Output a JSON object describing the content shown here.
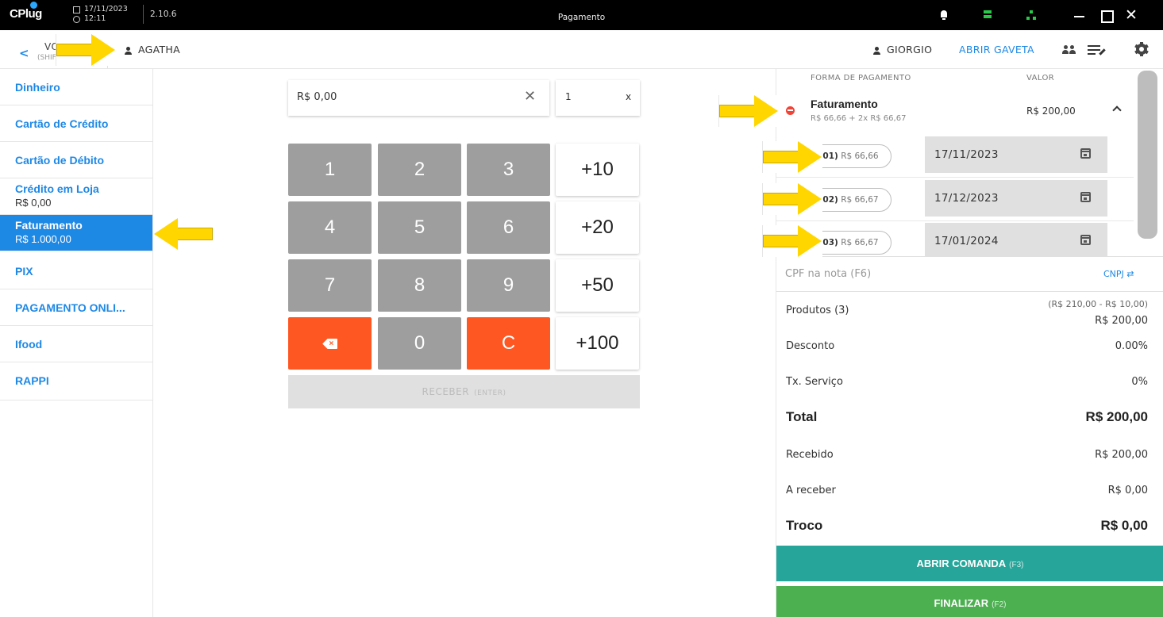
{
  "titlebar": {
    "brand": "CPlug",
    "date": "17/11/2023",
    "time": "12:11",
    "version": "2.10.6",
    "window_title": "Pagamento"
  },
  "header": {
    "back_label": "VOLTAR",
    "back_hint": "(SHIFT+ESC)",
    "client": "AGATHA",
    "operator": "GIORGIO",
    "open_drawer": "ABRIR GAVETA"
  },
  "sidebar": {
    "methods": [
      {
        "label": "Dinheiro",
        "balance": ""
      },
      {
        "label": "Cartão de Crédito",
        "balance": ""
      },
      {
        "label": "Cartão de Débito",
        "balance": ""
      },
      {
        "label": "Crédito em Loja",
        "balance": "R$ 0,00"
      },
      {
        "label": "Faturamento",
        "balance": "R$ 1.000,00",
        "selected": true
      },
      {
        "label": "PIX",
        "balance": ""
      },
      {
        "label": "PAGAMENTO ONLI...",
        "balance": ""
      },
      {
        "label": "Ifood",
        "balance": ""
      },
      {
        "label": "RAPPI",
        "balance": ""
      }
    ]
  },
  "entry": {
    "amount": "R$ 0,00",
    "quantity": "1",
    "quantity_suffix": "x"
  },
  "keypad": {
    "digits": [
      "1",
      "2",
      "3",
      "4",
      "5",
      "6",
      "7",
      "8",
      "9",
      "0"
    ],
    "quick": [
      "+10",
      "+20",
      "+50",
      "+100"
    ],
    "clear": "C",
    "receive_label": "RECEBER",
    "receive_hint": "(ENTER)"
  },
  "payments": {
    "col_method": "FORMA DE PAGAMENTO",
    "col_value": "VALOR",
    "method": "Faturamento",
    "detail": "R$ 66,66 + 2x R$ 66,67",
    "value": "R$ 200,00",
    "installments": [
      {
        "num": "01)",
        "amount": "R$ 66,66",
        "date": "17/11/2023"
      },
      {
        "num": "02)",
        "amount": "R$ 66,67",
        "date": "17/12/2023"
      },
      {
        "num": "03)",
        "amount": "R$ 66,67",
        "date": "17/01/2024"
      }
    ]
  },
  "cpf": {
    "placeholder": "CPF na nota (F6)",
    "toggle": "CNPJ"
  },
  "summary": {
    "products_label": "Produtos (3)",
    "products_breakdown": "(R$ 210,00 - R$ 10,00)",
    "products_value": "R$ 200,00",
    "discount_label": "Desconto",
    "discount_value": "0.00%",
    "service_label": "Tx. Serviço",
    "service_value": "0%",
    "total_label": "Total",
    "total_value": "R$ 200,00",
    "received_label": "Recebido",
    "received_value": "R$ 200,00",
    "to_receive_label": "A receber",
    "to_receive_value": "R$ 0,00",
    "change_label": "Troco",
    "change_value": "R$ 0,00"
  },
  "actions": {
    "open_order": "ABRIR COMANDA",
    "open_order_hint": "(F3)",
    "finish": "FINALIZAR",
    "finish_hint": "(F2)"
  },
  "colors": {
    "accent": "#1e88e5",
    "orange": "#ff5722",
    "teal": "#26a69a",
    "green": "#4caf50",
    "annotation": "#ffd600"
  }
}
